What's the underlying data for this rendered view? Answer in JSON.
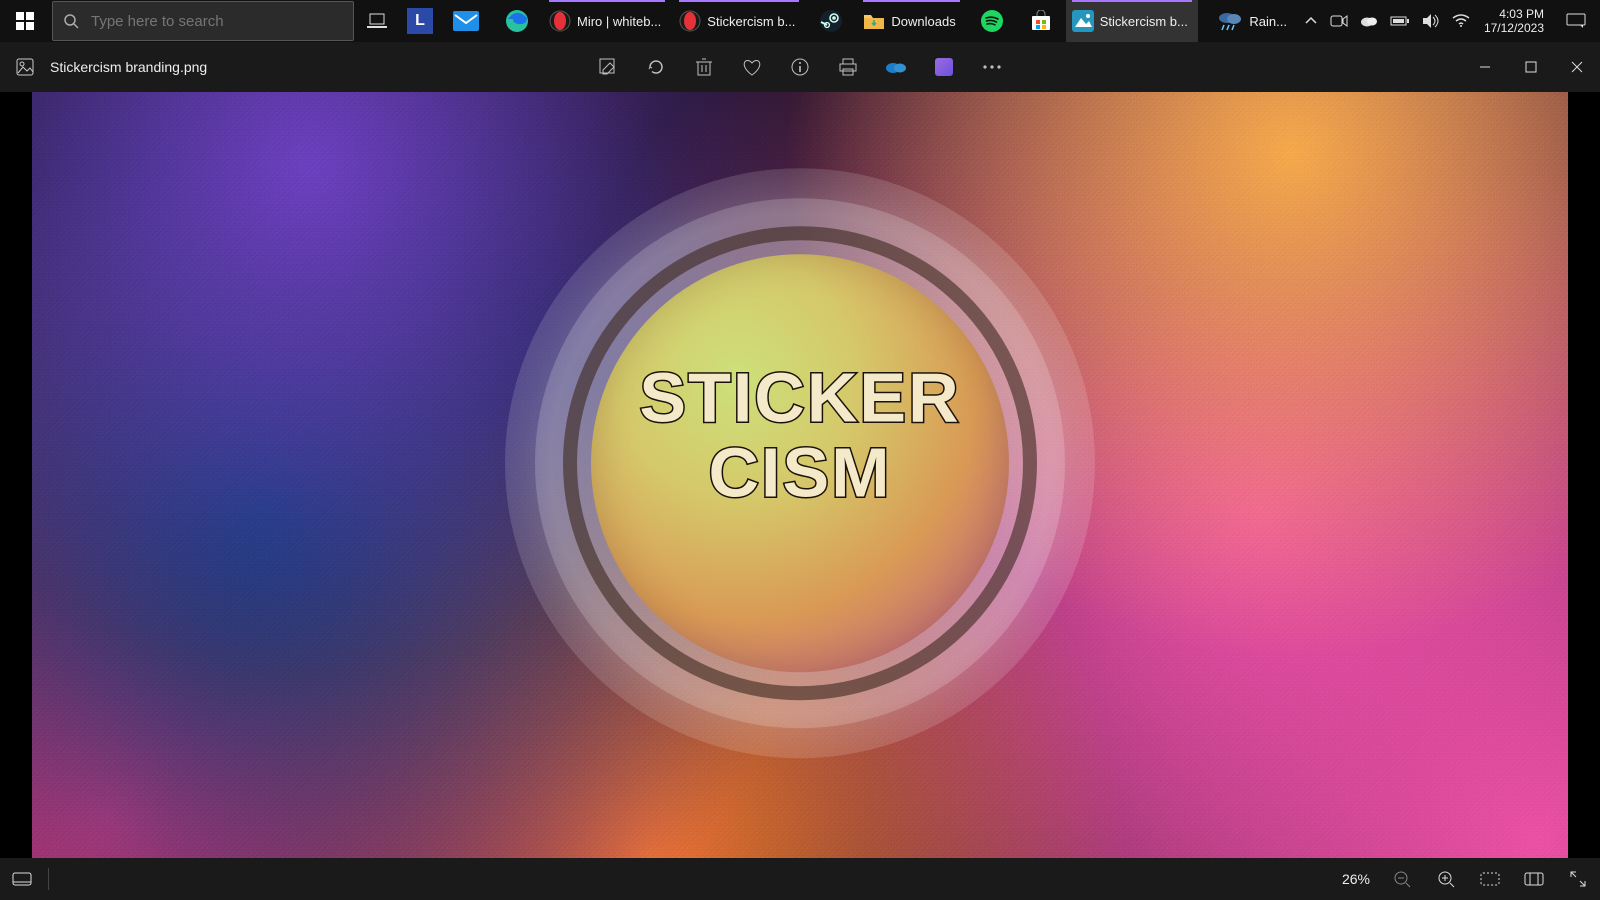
{
  "taskbar": {
    "search_placeholder": "Type here to search",
    "items": [
      {
        "label": "Miro | whiteb..."
      },
      {
        "label": "Stickercism b..."
      },
      {
        "label": "Downloads"
      },
      {
        "label": "Stickercism b..."
      }
    ],
    "weather": "Rain...",
    "time": "4:03 PM",
    "date": "17/12/2023"
  },
  "app": {
    "filename": "Stickercism branding.png"
  },
  "image": {
    "brand_line1": "STICKER",
    "brand_line2": "CISM"
  },
  "status": {
    "zoom": "26%"
  }
}
